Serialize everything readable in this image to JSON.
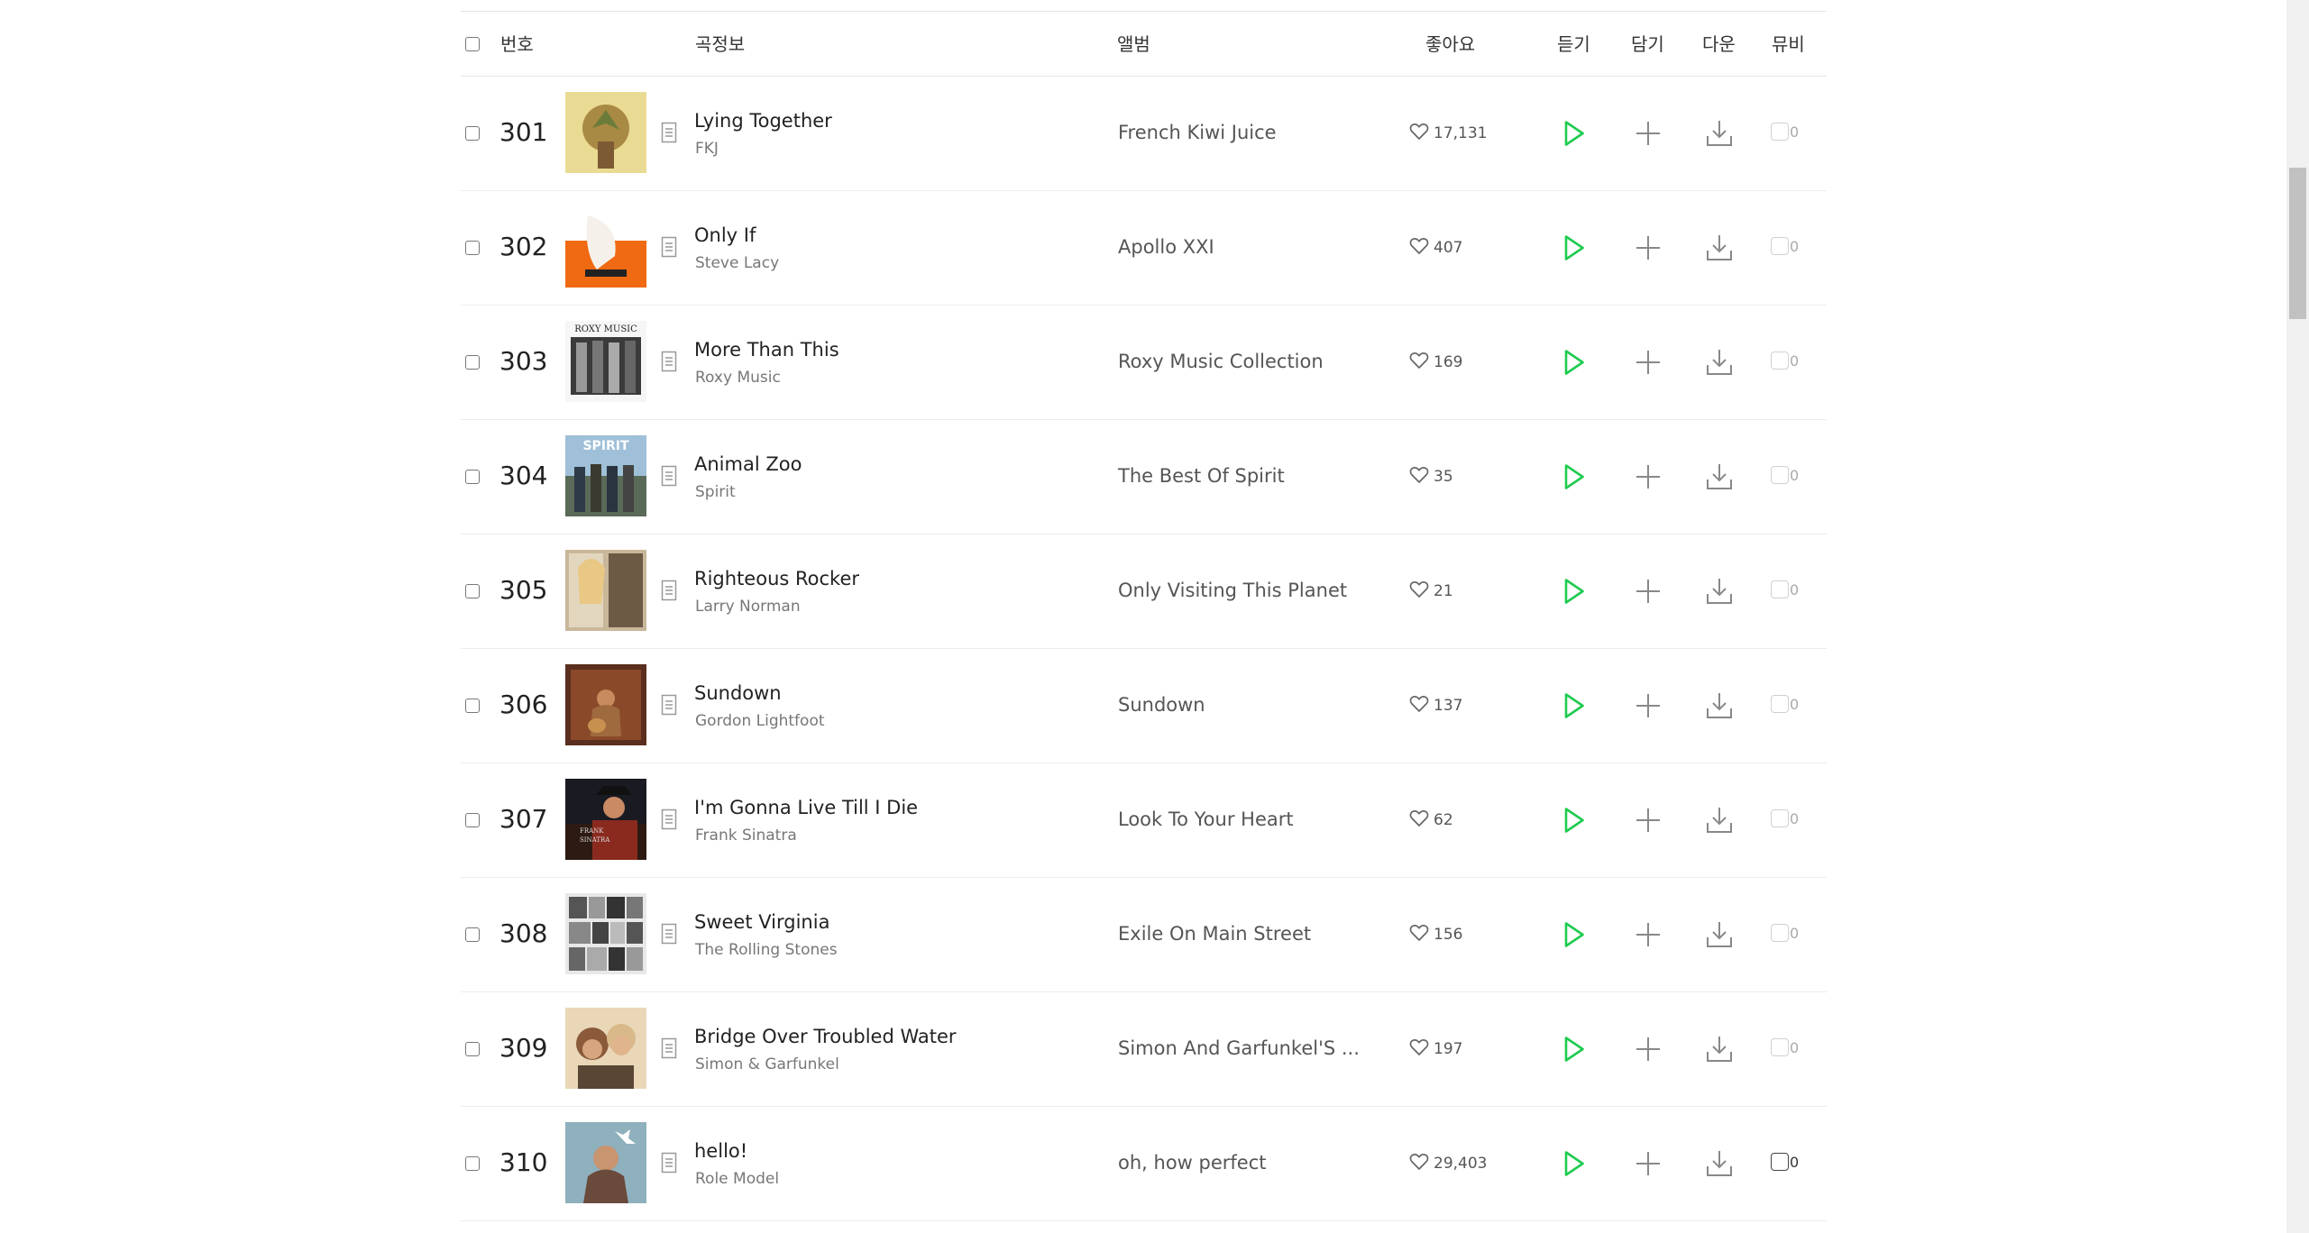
{
  "header": {
    "number": "번호",
    "song_info": "곡정보",
    "album": "앨범",
    "likes": "좋아요",
    "listen": "듣기",
    "add": "담기",
    "download": "다운",
    "mv": "뮤비"
  },
  "colors": {
    "play_green": "#1ecb4f",
    "icon_gray": "#888888",
    "like_gray": "#666666"
  },
  "icons": {
    "like": "heart-icon",
    "play": "play-icon",
    "add": "plus-icon",
    "download": "download-icon",
    "lyrics": "document-icon"
  },
  "tracks": [
    {
      "rank": "301",
      "title": "Lying Together",
      "artist": "FKJ",
      "album": "French Kiwi Juice",
      "likes": "17,131",
      "mv": "0"
    },
    {
      "rank": "302",
      "title": "Only If",
      "artist": "Steve Lacy",
      "album": "Apollo XXI",
      "likes": "407",
      "mv": "0"
    },
    {
      "rank": "303",
      "title": "More Than This",
      "artist": "Roxy Music",
      "album": "Roxy Music Collection",
      "likes": "169",
      "mv": "0",
      "cover_text": "ROXY MUSIC"
    },
    {
      "rank": "304",
      "title": "Animal Zoo",
      "artist": "Spirit",
      "album": "The Best Of Spirit",
      "likes": "35",
      "mv": "0",
      "cover_text": "SPIRIT"
    },
    {
      "rank": "305",
      "title": "Righteous Rocker",
      "artist": "Larry Norman",
      "album": "Only Visiting This Planet",
      "likes": "21",
      "mv": "0"
    },
    {
      "rank": "306",
      "title": "Sundown",
      "artist": "Gordon Lightfoot",
      "album": "Sundown",
      "likes": "137",
      "mv": "0"
    },
    {
      "rank": "307",
      "title": "I'm Gonna Live Till I Die",
      "artist": "Frank Sinatra",
      "album": "Look To Your Heart",
      "likes": "62",
      "mv": "0"
    },
    {
      "rank": "308",
      "title": "Sweet Virginia",
      "artist": "The Rolling Stones",
      "album": "Exile On Main Street",
      "likes": "156",
      "mv": "0"
    },
    {
      "rank": "309",
      "title": "Bridge Over Troubled Water",
      "artist": "Simon & Garfunkel",
      "album": "Simon And Garfunkel'S ...",
      "likes": "197",
      "mv": "0"
    },
    {
      "rank": "310",
      "title": "hello!",
      "artist": "Role Model",
      "album": "oh, how perfect",
      "likes": "29,403",
      "mv": "0"
    }
  ]
}
